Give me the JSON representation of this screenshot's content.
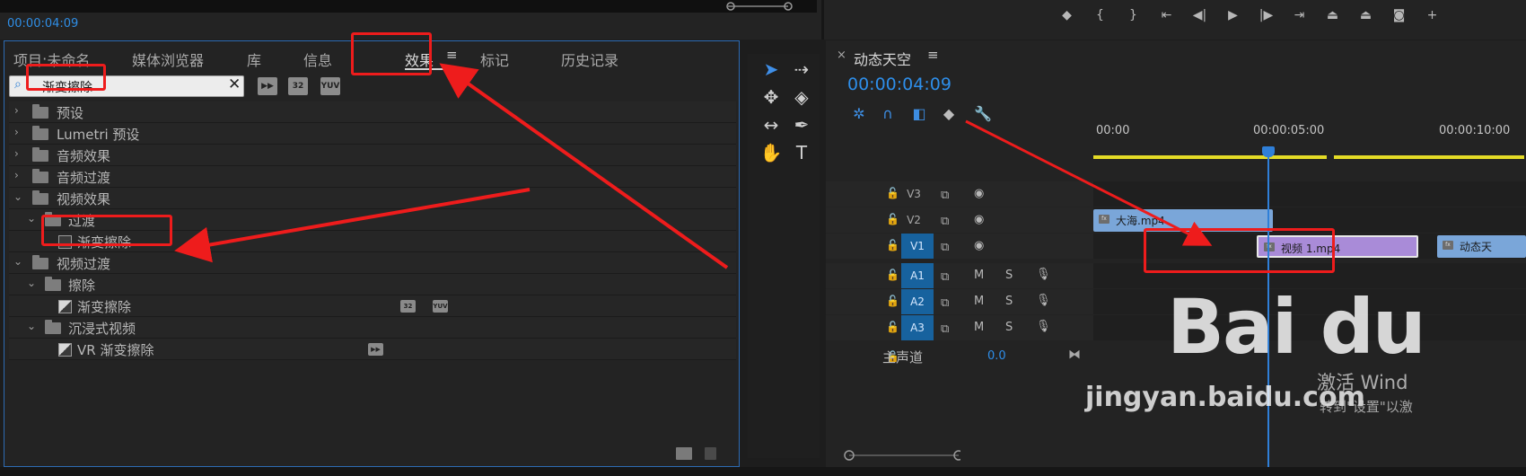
{
  "top": {
    "timecode": "00:00:04:09"
  },
  "effects_panel": {
    "tabs": [
      "项目:未命名",
      "媒体浏览器",
      "库",
      "信息",
      "效果",
      "标记",
      "历史记录"
    ],
    "active_tab": "效果",
    "menu_icon": "≡",
    "search": {
      "value": "渐变擦除",
      "clear": "✕"
    },
    "filter_buttons": [
      "accelerated-effects",
      "32",
      "YUV"
    ],
    "tree": [
      {
        "label": "预设",
        "type": "folder-star",
        "expanded": false,
        "level": 0
      },
      {
        "label": "Lumetri 预设",
        "type": "folder-star",
        "expanded": false,
        "level": 0
      },
      {
        "label": "音频效果",
        "type": "folder",
        "expanded": false,
        "level": 0
      },
      {
        "label": "音频过渡",
        "type": "folder",
        "expanded": false,
        "level": 0
      },
      {
        "label": "视频效果",
        "type": "folder",
        "expanded": true,
        "level": 0
      },
      {
        "label": "过渡",
        "type": "folder",
        "expanded": true,
        "level": 1
      },
      {
        "label": "渐变擦除",
        "type": "effect",
        "level": 2
      },
      {
        "label": "视频过渡",
        "type": "folder",
        "expanded": true,
        "level": 0
      },
      {
        "label": "擦除",
        "type": "folder",
        "expanded": true,
        "level": 1
      },
      {
        "label": "渐变擦除",
        "type": "transition",
        "level": 2,
        "badges": [
          "32",
          "YUV"
        ]
      },
      {
        "label": "沉浸式视频",
        "type": "folder",
        "expanded": true,
        "level": 1
      },
      {
        "label": "VR 渐变擦除",
        "type": "transition",
        "level": 2,
        "badges": [
          "accel"
        ]
      }
    ]
  },
  "timeline": {
    "sequence_name": "动态天空",
    "close": "×",
    "menu_icon": "≡",
    "timecode": "00:00:04:09",
    "ruler": [
      "00:00",
      "00:00:05:00",
      "00:00:10:00"
    ],
    "tracks": [
      {
        "name": "V3",
        "kind": "video",
        "selected": false
      },
      {
        "name": "V2",
        "kind": "video",
        "selected": false
      },
      {
        "name": "V1",
        "kind": "video",
        "selected": true
      },
      {
        "name": "A1",
        "kind": "audio",
        "selected": true,
        "m": "M",
        "s": "S"
      },
      {
        "name": "A2",
        "kind": "audio",
        "selected": true,
        "m": "M",
        "s": "S"
      },
      {
        "name": "A3",
        "kind": "audio",
        "selected": true,
        "m": "M",
        "s": "S"
      }
    ],
    "master": {
      "label": "主声道",
      "value": "0.0"
    },
    "clips": {
      "v2": "大海.mp4",
      "v1": "视频 1.mp4",
      "v1_next": "动态天"
    }
  },
  "watermark": {
    "brand": "Bai du",
    "site": "jingyan.baidu.com",
    "activate": "激活 Wind",
    "activate_sub": "转到\"设置\"以激"
  },
  "colors": {
    "accent_blue": "#2e8ee9",
    "annotation_red": "#ee1c1c",
    "clip_blue": "#7aa6d9",
    "clip_purple": "#a98bd8",
    "playhead_yellow": "#e4db26"
  }
}
